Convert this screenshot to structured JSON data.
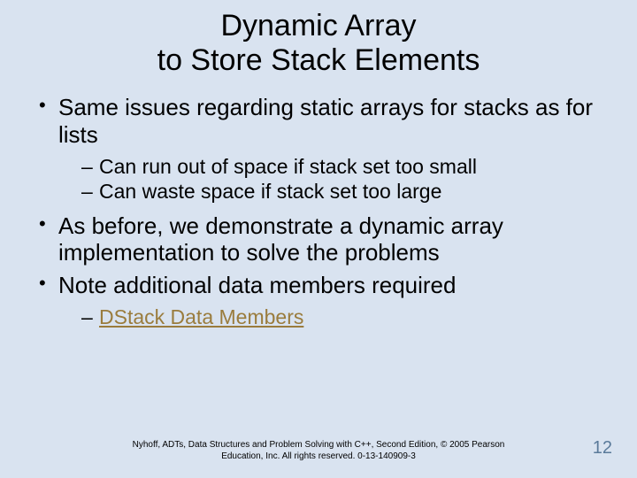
{
  "title_line1": "Dynamic Array",
  "title_line2": "to Store Stack Elements",
  "bullets": {
    "b1": "Same issues regarding static arrays for stacks as for lists",
    "b1_sub1": "Can run out of space if stack set too small",
    "b1_sub2": "Can waste space if stack set too large",
    "b2": "As before, we demonstrate a dynamic array implementation to solve the problems",
    "b3": "Note additional data members required",
    "b3_sub1": "DStack Data Members"
  },
  "footer_line1": "Nyhoff, ADTs, Data Structures and Problem Solving with C++, Second Edition, © 2005 Pearson",
  "footer_line2": "Education, Inc. All rights reserved. 0-13-140909-3",
  "page_number": "12"
}
